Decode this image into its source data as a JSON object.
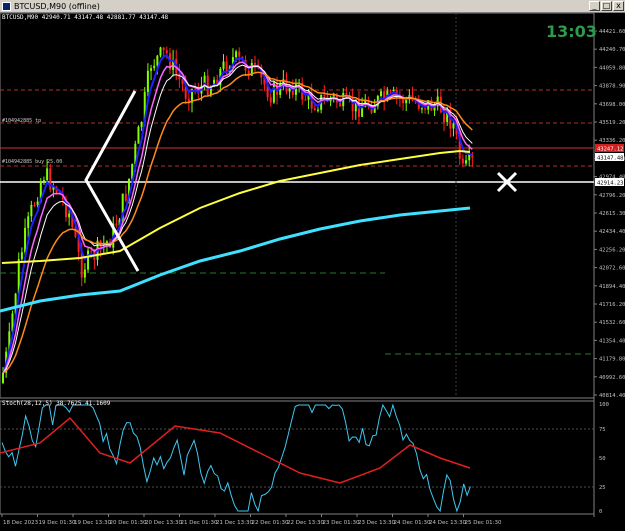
{
  "window": {
    "title": "BTCUSD,M90 (offline)",
    "minimize_label": "_",
    "maximize_label": "□",
    "close_label": "x"
  },
  "chart": {
    "info_line": "BTCUSD,M90  42940.71 43147.48 42881.77 43147.48",
    "clock": "13:03",
    "line_labels": [
      "#104942885 tp",
      "#104942885 buy 25.00"
    ],
    "price_labels": [
      "44421.60",
      "44240.70",
      "44059.80",
      "43878.90",
      "43698.00",
      "43519.20",
      "43336.20",
      "43155.30",
      "42974.40",
      "42796.20",
      "42615.30",
      "42434.40",
      "42256.20",
      "42072.60",
      "41894.40",
      "41716.20",
      "41532.60",
      "41354.40",
      "41179.80",
      "40992.60",
      "40814.40"
    ],
    "current_price_tag": "43147.48",
    "entry_price_tag": "42914.23",
    "tp_price_tag": "43247.12",
    "indicator_info": "Stoch(28,12,5) 38.7625 41.1609",
    "stoch_levels": [
      "100",
      "75",
      "50",
      "25",
      "0"
    ],
    "time_labels": [
      "18 Dec 2023",
      "19 Dec 01:30",
      "19 Dec 13:30",
      "20 Dec 01:30",
      "20 Dec 13:30",
      "21 Dec 01:30",
      "21 Dec 13:30",
      "22 Dec 01:30",
      "22 Dec 13:30",
      "23 Dec 01:30",
      "23 Dec 13:30",
      "24 Dec 01:30",
      "24 Dec 13:30",
      "25 Dec 01:30"
    ],
    "colors": {
      "bull": "#7fff00",
      "bear": "#ff2020",
      "ma_fast": "#2020ff",
      "ma_2": "#ff66ff",
      "ma_3": "#ffffff",
      "ma_4": "#ff8c1a",
      "ma_5": "#ffff40",
      "ma_slow": "#40e0ff",
      "stoch_main": "#40c8f0",
      "stoch_signal": "#e02020"
    }
  }
}
